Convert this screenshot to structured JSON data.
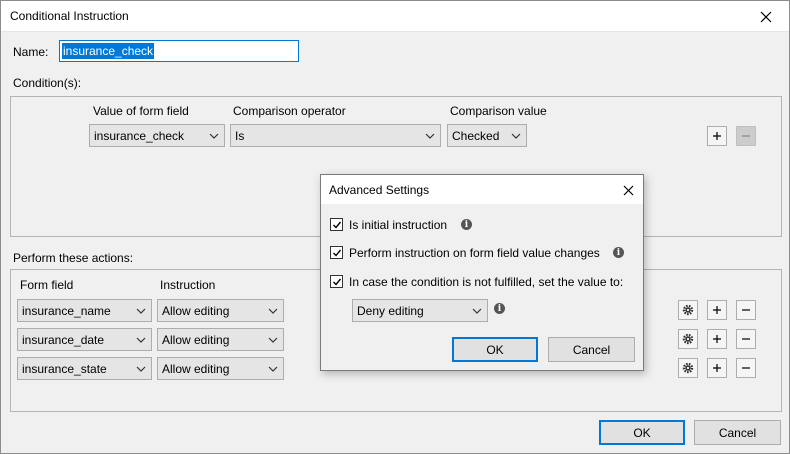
{
  "window": {
    "title": "Conditional Instruction",
    "ok_label": "OK",
    "cancel_label": "Cancel"
  },
  "name_field": {
    "label": "Name:",
    "value": "insurance_check"
  },
  "conditions": {
    "label": "Condition(s):",
    "headers": [
      "Value of form field",
      "Comparison operator",
      "Comparison value"
    ],
    "rows": [
      {
        "field": "insurance_check",
        "operator": "Is",
        "value": "Checked"
      }
    ]
  },
  "actions": {
    "label": "Perform these actions:",
    "headers": [
      "Form field",
      "Instruction"
    ],
    "rows": [
      {
        "field": "insurance_name",
        "instruction": "Allow editing"
      },
      {
        "field": "insurance_date",
        "instruction": "Allow editing"
      },
      {
        "field": "insurance_state",
        "instruction": "Allow editing"
      }
    ]
  },
  "advanced": {
    "title": "Advanced Settings",
    "options": [
      {
        "label": "Is initial instruction",
        "checked": true
      },
      {
        "label": "Perform instruction on form field value changes",
        "checked": true
      },
      {
        "label": "In case the condition is not fulfilled, set the value to:",
        "checked": true
      }
    ],
    "fallback_value": "Deny editing",
    "ok_label": "OK",
    "cancel_label": "Cancel"
  }
}
